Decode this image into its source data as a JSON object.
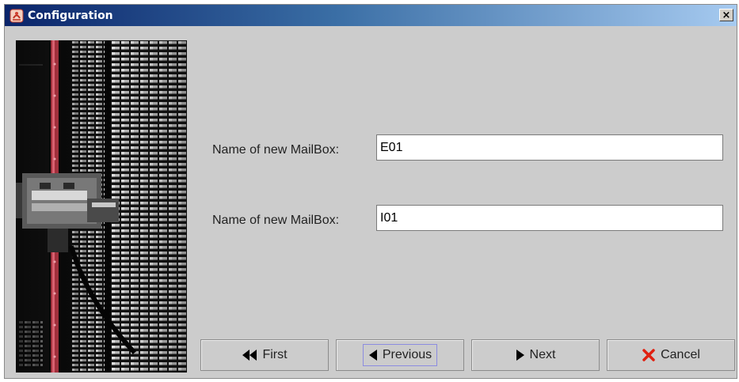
{
  "window": {
    "title": "Configuration",
    "close_label": "×"
  },
  "form": {
    "field1": {
      "label": "Name of new MailBox:",
      "value": "E01"
    },
    "field2": {
      "label": "Name of new MailBox:",
      "value": "I01"
    }
  },
  "buttons": {
    "first": {
      "label": "First",
      "icon": "double-left-arrow-icon"
    },
    "previous": {
      "label": "Previous",
      "icon": "left-triangle-icon"
    },
    "next": {
      "label": "Next",
      "icon": "right-triangle-icon"
    },
    "cancel": {
      "label": "Cancel",
      "icon": "red-x-icon"
    }
  },
  "colors": {
    "title_gradient_start": "#0a246a",
    "title_gradient_end": "#a6caf0",
    "window_bg": "#cccccc",
    "cancel_icon": "#e02010"
  }
}
